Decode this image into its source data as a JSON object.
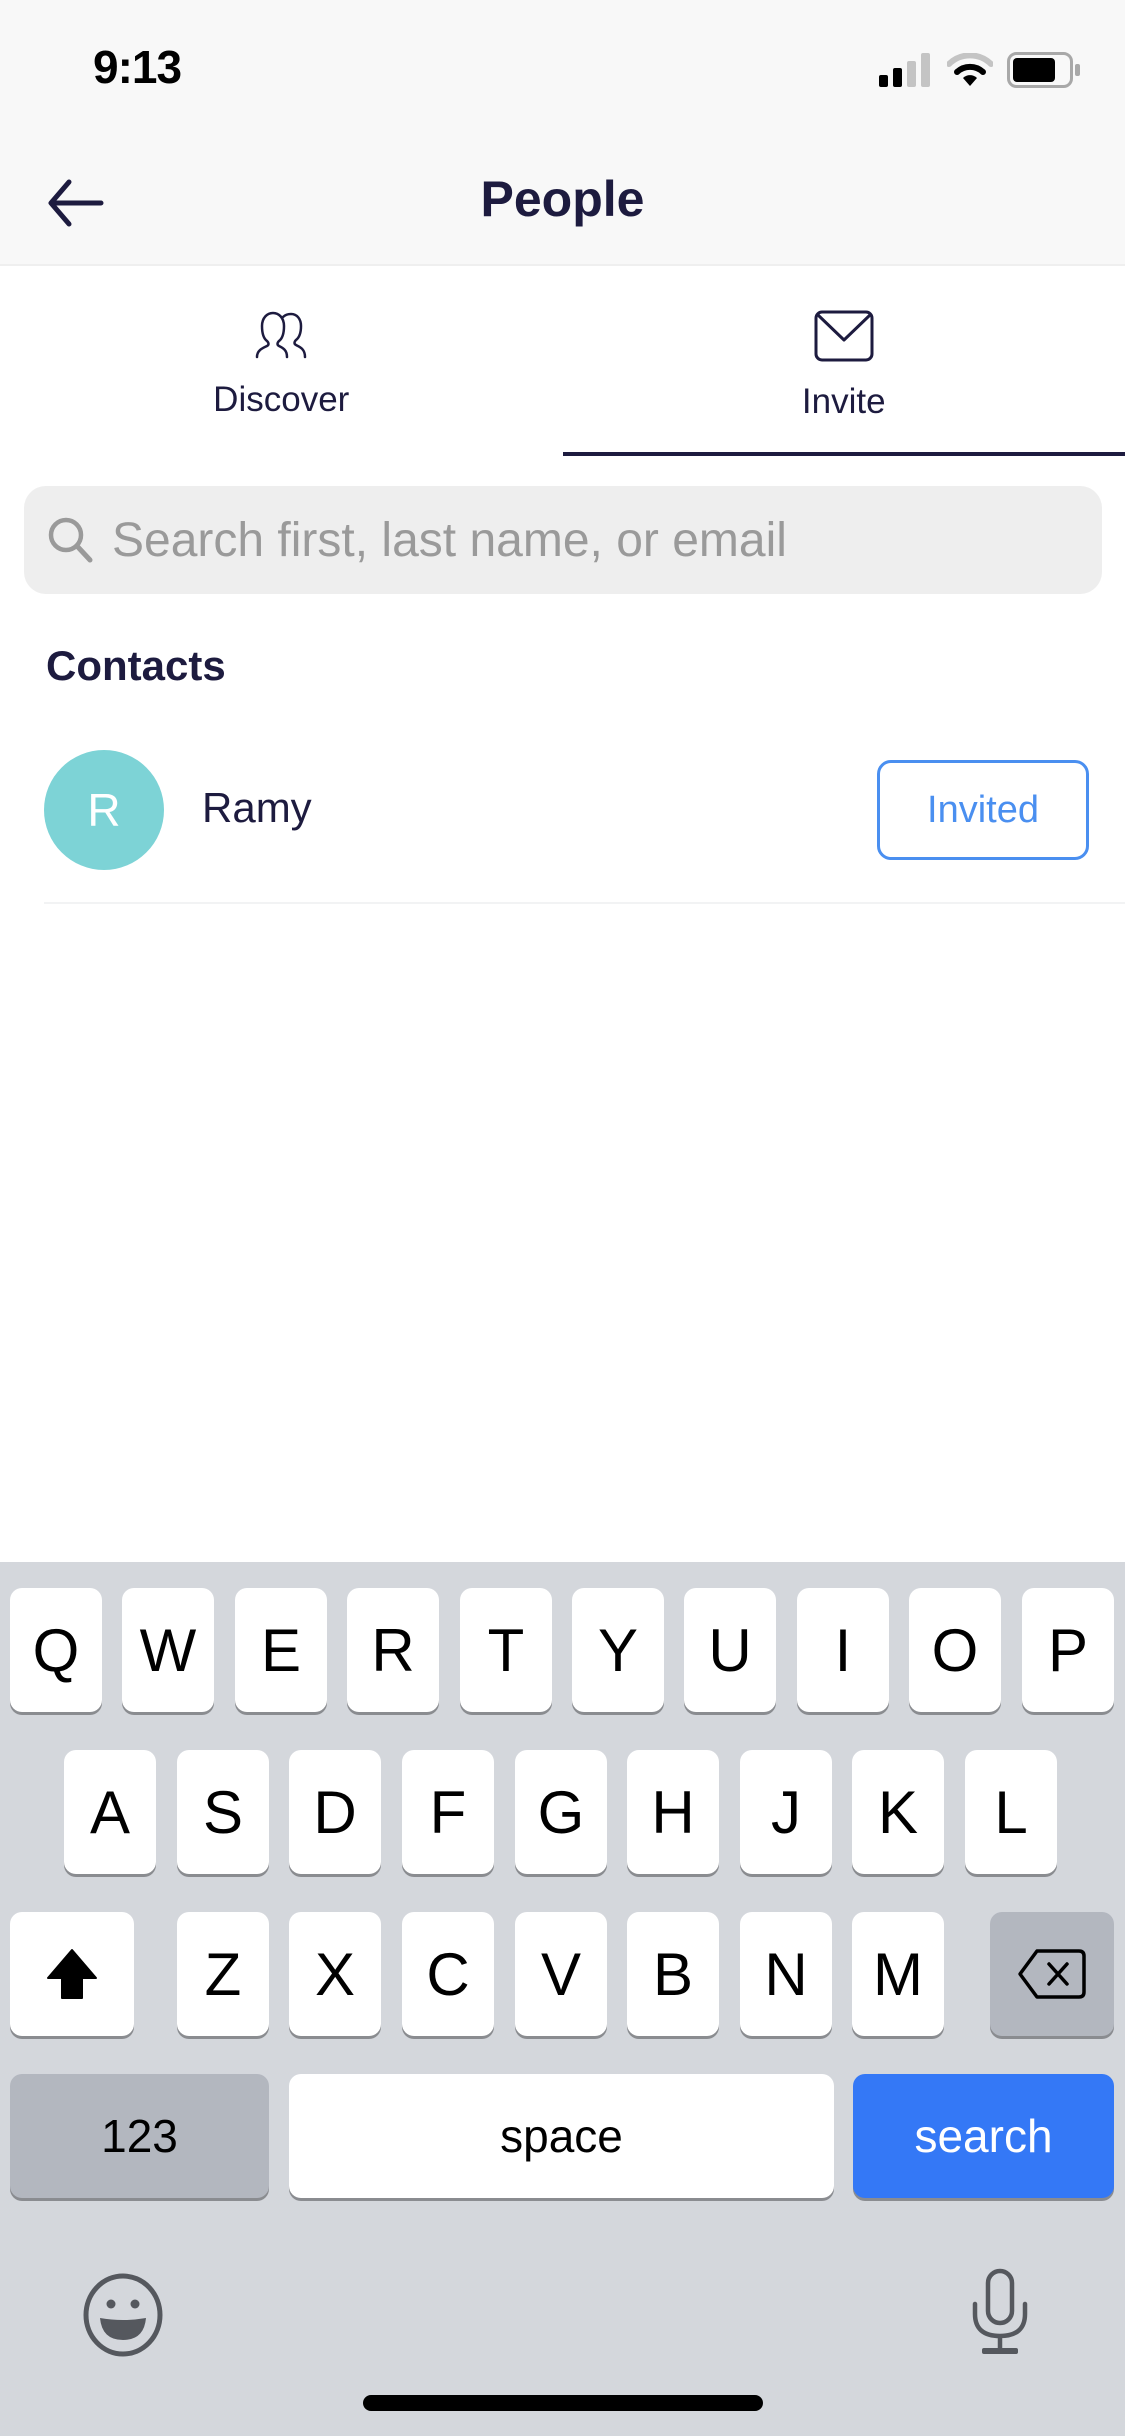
{
  "status_bar": {
    "time": "9:13",
    "icons": [
      "signal-icon",
      "wifi-icon",
      "battery-icon"
    ]
  },
  "nav": {
    "title": "People",
    "back_icon": "arrow-left-icon"
  },
  "tabs": [
    {
      "label": "Discover",
      "icon": "people-icon",
      "active": false
    },
    {
      "label": "Invite",
      "icon": "envelope-icon",
      "active": true
    }
  ],
  "search": {
    "placeholder": "Search first, last name, or email",
    "value": "",
    "icon": "search-icon"
  },
  "contacts": {
    "section_title": "Contacts",
    "items": [
      {
        "initial": "R",
        "name": "Ramy",
        "action_label": "Invited",
        "avatar_color": "#7dd3d6"
      }
    ]
  },
  "keyboard": {
    "row1": [
      "Q",
      "W",
      "E",
      "R",
      "T",
      "Y",
      "U",
      "I",
      "O",
      "P"
    ],
    "row2": [
      "A",
      "S",
      "D",
      "F",
      "G",
      "H",
      "J",
      "K",
      "L"
    ],
    "row3": [
      "Z",
      "X",
      "C",
      "V",
      "B",
      "N",
      "M"
    ],
    "numbers_label": "123",
    "space_label": "space",
    "action_label": "search",
    "action_color": "#3478f6"
  },
  "colors": {
    "primary_text": "#1d1b3f",
    "accent": "#4a8ff0"
  }
}
